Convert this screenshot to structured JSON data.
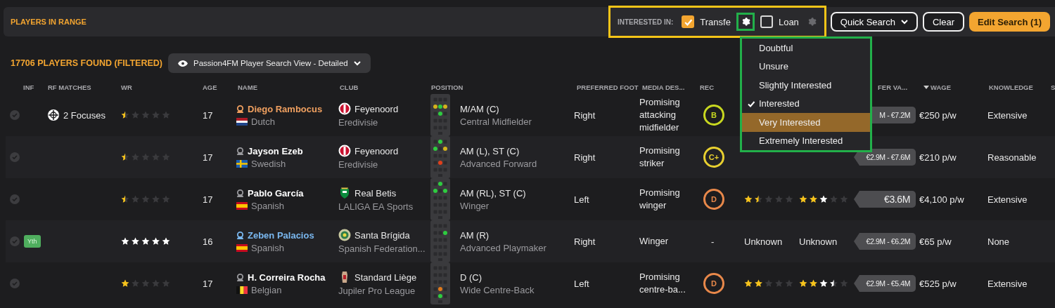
{
  "header": {
    "title": "PLAYERS IN RANGE",
    "interest": {
      "label": "INTERESTED IN:",
      "highlighted": true,
      "options": [
        {
          "label": "Transfe",
          "checked": true,
          "settings_highlighted": true,
          "settings_active": true
        },
        {
          "label": "Loan",
          "checked": false,
          "settings_active": false
        }
      ]
    },
    "buttons": [
      {
        "label": "Quick Search",
        "kind": "dropdown"
      },
      {
        "label": "Clear",
        "kind": "outline"
      },
      {
        "label": "Edit Search (1)",
        "kind": "primary"
      }
    ]
  },
  "summary": {
    "count": "17706 PLAYERS FOUND (FILTERED)",
    "view": "Passion4FM Player Search View - Detailed"
  },
  "columns": [
    {
      "label": "INF"
    },
    {
      "label": "RF MATCHES"
    },
    {
      "label": "WR"
    },
    {
      "label": "AGE"
    },
    {
      "label": "NAME"
    },
    {
      "label": "CLUB"
    },
    {
      "label": "POSITION"
    },
    {
      "label": "PREFERRED FOOT"
    },
    {
      "label": "MEDIA DES..."
    },
    {
      "label": "REC"
    },
    {},
    {},
    {
      "label": "FER VA..."
    },
    {
      "label": "WAGE",
      "sorted": true
    },
    {
      "label": "KNOWLEDGE"
    },
    {
      "label": "S"
    }
  ],
  "rows": [
    {
      "focus": "2 Focuses",
      "wr": {
        "stars": 0.5
      },
      "age": "17",
      "name": "Diego Rambocus",
      "color": "#f0a060",
      "flag": {
        "kind": "nl"
      },
      "nation": "Dutch",
      "crest": {
        "kind": "roundel"
      },
      "club": "Feyenoord",
      "league": "Eredivisie",
      "dots": [
        {
          "kind": "am-l",
          "color": "#d4b21c"
        },
        {
          "kind": "am-c",
          "color": "#2ecc40"
        },
        {
          "kind": "am-r",
          "color": "#d4b21c"
        },
        {
          "kind": "m-c",
          "color": "#2ecc40"
        }
      ],
      "position": "M/AM (C)",
      "role": "Central Midfielder",
      "foot": "Right",
      "media": "Promising attacking midfielder",
      "rec": {
        "grade": "B",
        "color": "#c8d820"
      },
      "value": "M - €7.2M",
      "wage": "€250 p/w",
      "knowledge": "Extensive"
    },
    {
      "wr": {
        "stars": 0.5
      },
      "age": "17",
      "name": "Jayson Ezeb",
      "color": "#ffffff",
      "flag": {
        "kind": "se"
      },
      "nation": "Swedish",
      "crest": {
        "kind": "roundel"
      },
      "club": "Feyenoord",
      "league": "Eredivisie",
      "dots": [
        {
          "kind": "st-c",
          "color": "#2ecc40"
        },
        {
          "kind": "am-l",
          "color": "#2ecc40"
        },
        {
          "kind": "am-r",
          "color": "#d4b21c"
        },
        {
          "kind": "dm-c",
          "color": "#e0401c"
        }
      ],
      "position": "AM (L), ST (C)",
      "role": "Advanced Forward",
      "foot": "Right",
      "media": "Promising striker",
      "rec": {
        "grade": "C+",
        "color": "#e8d030"
      },
      "value": "€2.9M - €7.6M",
      "wage": "€210 p/w",
      "knowledge": "Reasonable"
    },
    {
      "wr": {
        "stars": 0.5
      },
      "age": "17",
      "name": "Pablo García",
      "color": "#ffffff",
      "flag": {
        "kind": "es"
      },
      "nation": "Spanish",
      "crest": {
        "kind": "shield"
      },
      "club": "Real Betis",
      "league": "LALIGA EA Sports",
      "dots": [
        {
          "kind": "st-c",
          "color": "#2ecc40"
        },
        {
          "kind": "am-l",
          "color": "#2ecc40"
        },
        {
          "kind": "am-r",
          "color": "#2ecc40"
        }
      ],
      "position": "AM (RL), ST (C)",
      "role": "Winger",
      "foot": "Left",
      "media": "Promising winger",
      "rec": {
        "grade": "D",
        "color": "#e8884a"
      },
      "ability": {
        "stars": 1.5
      },
      "potential": {
        "stars": 2,
        "estimate": {
          "stars": 1
        }
      },
      "value": "€3.6M",
      "wage": "€4,100 p/w",
      "knowledge": "Extensive"
    },
    {
      "badge": "Yth",
      "wr": {
        "stars": 5
      },
      "wr_estimated": true,
      "age": "16",
      "name": "Zeben Palacios",
      "color": "#7ab8f0",
      "flag": {
        "kind": "es"
      },
      "nation": "Spanish",
      "crest": {
        "kind": "round"
      },
      "club": "Santa Brígida",
      "league": "Spanish Federation...",
      "dots": [
        {
          "kind": "am-r",
          "color": "#2ecc40"
        }
      ],
      "position": "AM (R)",
      "role": "Advanced Playmaker",
      "foot": "Right",
      "media": "Winger",
      "rec": {
        "grade": "-"
      },
      "ability_text": "Unknown",
      "potential_text": "Unknown",
      "value": "€2.9M - €6.2M",
      "wage": "€65 p/w",
      "knowledge": "None"
    },
    {
      "wr": {
        "stars": 1
      },
      "age": "17",
      "name": "H. Correira Rocha",
      "color": "#ffffff",
      "flag": {
        "kind": "be"
      },
      "nation": "Belgian",
      "crest": {
        "kind": "tall"
      },
      "club": "Standard Liège",
      "league": "Jupiler Pro League",
      "dots": [
        {
          "kind": "dm-c",
          "color": "#e07a1c"
        },
        {
          "kind": "d-c",
          "color": "#2ecc40"
        }
      ],
      "position": "D (C)",
      "role": "Wide Centre-Back",
      "foot": "Left",
      "media": "Promising centre-ba...",
      "rec": {
        "grade": "D",
        "color": "#e8884a"
      },
      "ability": {
        "stars": 2
      },
      "potential": {
        "stars": 2,
        "estimate": {
          "stars": 1.5
        }
      },
      "value": "€2.9M - €5.4M",
      "wage": "€525 p/w",
      "knowledge": "Extensive"
    }
  ],
  "menu": {
    "highlighted": true,
    "items": [
      {
        "label": "Doubtful",
        "checked": false,
        "highlighted": false
      },
      {
        "label": "Unsure",
        "checked": false,
        "highlighted": false
      },
      {
        "label": "Slightly Interested",
        "checked": false,
        "highlighted": false
      },
      {
        "label": "Interested",
        "checked": true,
        "highlighted": false
      },
      {
        "label": "Very Interested",
        "checked": false,
        "highlighted": true
      },
      {
        "label": "Extremely Interested",
        "checked": false,
        "highlighted": false
      }
    ]
  }
}
